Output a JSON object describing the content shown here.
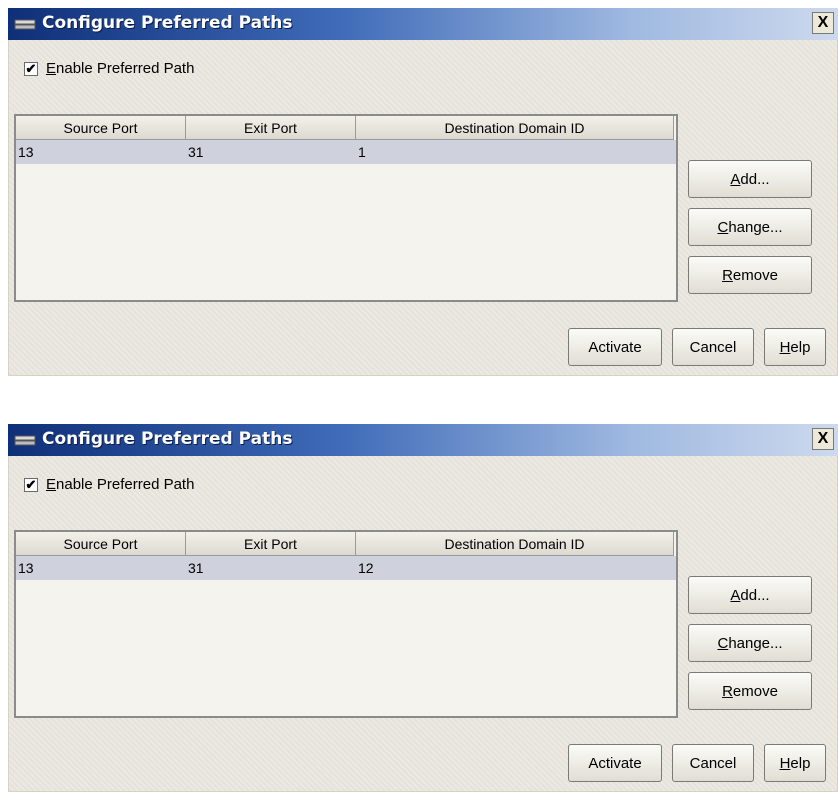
{
  "dialogs": [
    {
      "title": "Configure Preferred Paths",
      "close_label": "X",
      "enable_checked": true,
      "enable_label_mnemonic": "E",
      "enable_label_rest": "nable Preferred Path",
      "columns": [
        "Source Port",
        "Exit Port",
        "Destination Domain ID"
      ],
      "rows": [
        [
          "13",
          "31",
          "1"
        ]
      ],
      "buttons": {
        "add": {
          "mnemonic": "A",
          "rest": "dd..."
        },
        "change": {
          "mnemonic": "C",
          "rest": "hange..."
        },
        "remove": {
          "mnemonic": "R",
          "rest": "emove"
        },
        "activate": "Activate",
        "cancel": "Cancel",
        "help": {
          "mnemonic": "H",
          "rest": "elp"
        }
      }
    },
    {
      "title": "Configure Preferred Paths",
      "close_label": "X",
      "enable_checked": true,
      "enable_label_mnemonic": "E",
      "enable_label_rest": "nable Preferred Path",
      "columns": [
        "Source Port",
        "Exit Port",
        "Destination Domain ID"
      ],
      "rows": [
        [
          "13",
          "31",
          "12"
        ]
      ],
      "buttons": {
        "add": {
          "mnemonic": "A",
          "rest": "dd..."
        },
        "change": {
          "mnemonic": "C",
          "rest": "hange..."
        },
        "remove": {
          "mnemonic": "R",
          "rest": "emove"
        },
        "activate": "Activate",
        "cancel": "Cancel",
        "help": {
          "mnemonic": "H",
          "rest": "elp"
        }
      }
    }
  ],
  "icons": {
    "title_icon": "window-app-icon",
    "close_icon": "close-icon",
    "checkbox_mark": "checkmark-icon"
  },
  "colors": {
    "titlebar_start": "#0f2f78",
    "titlebar_end": "#cdd9ee",
    "dialog_bg": "#e9e7de",
    "selected_row": "#cfd2dc"
  }
}
